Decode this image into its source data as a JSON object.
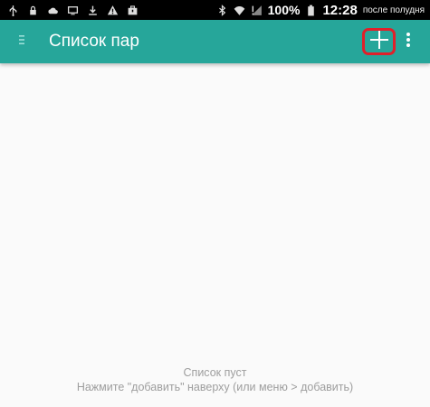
{
  "status_bar": {
    "left_icons": [
      "usb-icon",
      "lock-icon",
      "cloud-upload-icon",
      "screen-icon",
      "download-icon",
      "warning-icon",
      "briefcase-icon"
    ],
    "right_icons": [
      "bluetooth-icon",
      "wifi-icon",
      "signal-icon"
    ],
    "battery": "100%",
    "time": "12:28",
    "time_suffix": "после полудня"
  },
  "app_bar": {
    "title": "Список пар",
    "color": "#26a69a",
    "add_highlight_color": "#e0202a"
  },
  "empty_state": {
    "title": "Список пуст",
    "hint": "Нажмите \"добавить\" наверху (или меню > добавить)"
  }
}
